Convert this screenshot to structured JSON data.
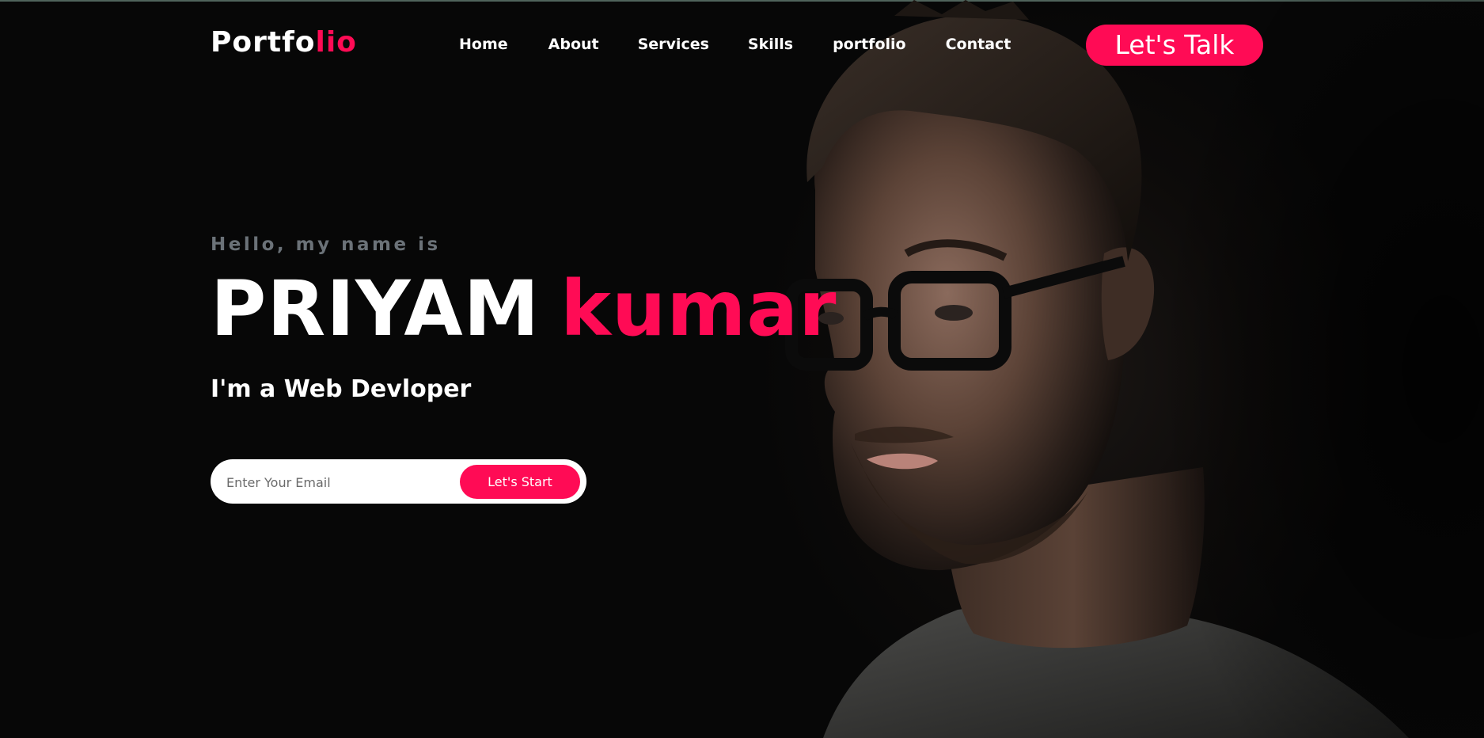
{
  "nav": {
    "logo_main": "Portfo",
    "logo_accent": "lio",
    "links": [
      "Home",
      "About",
      "Services",
      "Skills",
      "portfolio",
      "Contact"
    ],
    "cta_label": "Let's Talk"
  },
  "hero": {
    "greeting": "Hello, my name is",
    "first_name": "PRIYAM",
    "last_name": "kumar",
    "role": "I'm a Web Devloper",
    "email_placeholder": "Enter Your Email",
    "submit_label": "Let's Start"
  },
  "colors": {
    "accent": "#ff0b55",
    "background": "#070707",
    "text": "#ffffff",
    "muted": "#6b7278"
  },
  "image": {
    "subject": "portrait of man with glasses"
  }
}
